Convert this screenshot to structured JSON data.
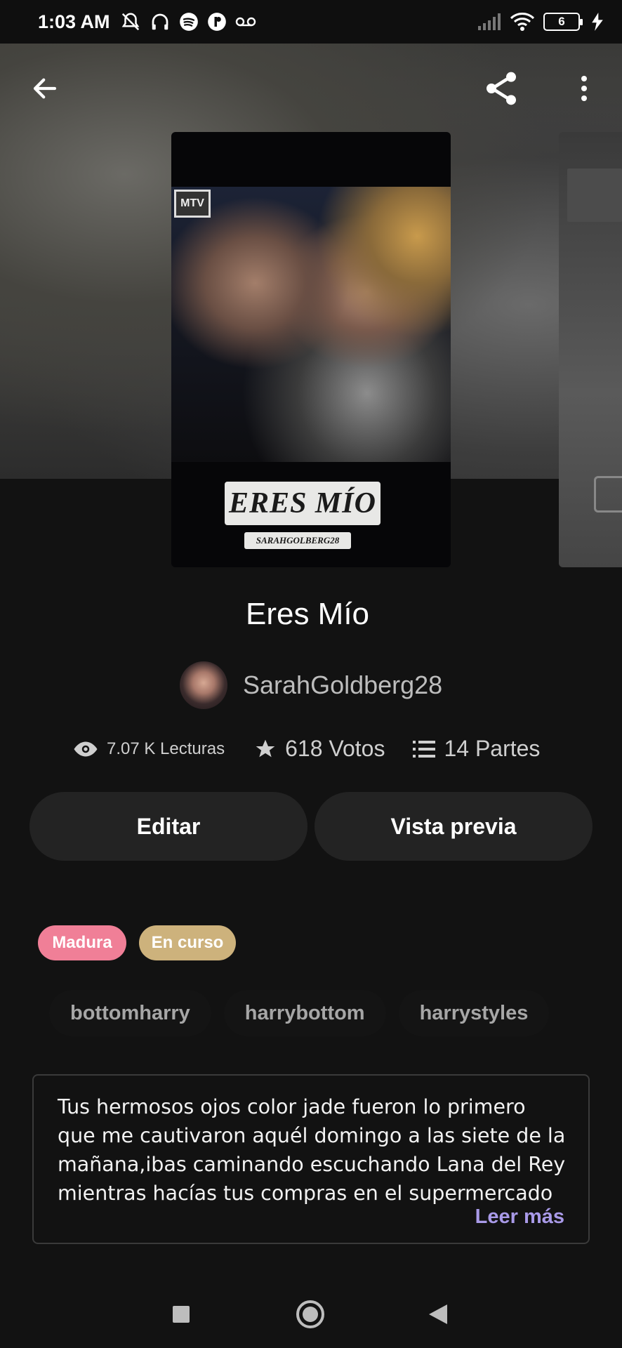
{
  "status_bar": {
    "time": "1:03 AM",
    "battery_level": "6",
    "icons_left": [
      "mute-icon",
      "headphones-icon",
      "spotify-icon",
      "app-icon",
      "voicemail-icon"
    ],
    "icons_right": [
      "signal-icon",
      "wifi-icon",
      "battery-icon",
      "charging-icon"
    ]
  },
  "header": {
    "back_icon": "arrow-left-icon",
    "share_icon": "share-icon",
    "more_icon": "more-vertical-icon"
  },
  "cover": {
    "logo_text": "MTV",
    "title_text": "ERES MÍO",
    "author_text": "SARAHGOLBERG28"
  },
  "story": {
    "title": "Eres Mío",
    "author": "SarahGoldberg28"
  },
  "stats": {
    "reads": "7.07 K Lecturas",
    "votes": "618 Votos",
    "parts": "14 Partes"
  },
  "actions": {
    "edit_label": "Editar",
    "preview_label": "Vista previa"
  },
  "badges": {
    "mature": "Madura",
    "ongoing": "En curso",
    "mature_color": "#f07f97",
    "ongoing_color": "#cdb27c"
  },
  "tags": [
    "bottomharry",
    "harrybottom",
    "harrystyles"
  ],
  "description": {
    "text": "Tus hermosos ojos color jade fueron lo primero que me cautivaron aquél domingo a las siete de la mañana,ibas caminando escuchando Lana del Rey mientras hacías tus compras en el supermercado",
    "read_more": "Leer más",
    "accent_color": "#a99ae8"
  },
  "nav_bar": {
    "recent_icon": "square-icon",
    "home_icon": "circle-icon",
    "back_icon": "triangle-back-icon"
  }
}
